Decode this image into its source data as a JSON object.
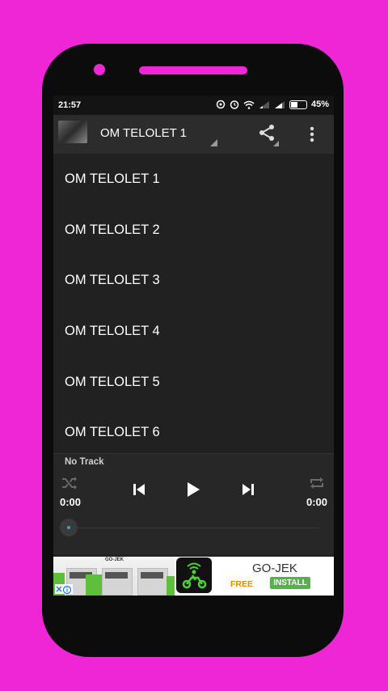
{
  "status_bar": {
    "time": "21:57",
    "battery": "45%"
  },
  "app_bar": {
    "title": "OM TELOLET 1"
  },
  "tracks": [
    {
      "label": "OM TELOLET 1"
    },
    {
      "label": "OM TELOLET 2"
    },
    {
      "label": "OM TELOLET 3"
    },
    {
      "label": "OM TELOLET 4"
    },
    {
      "label": "OM TELOLET 5"
    },
    {
      "label": "OM TELOLET 6"
    }
  ],
  "player": {
    "track_name": "No Track",
    "elapsed": "0:00",
    "duration": "0:00",
    "progress": 0
  },
  "ad": {
    "header": "GO-JEK",
    "app_name": "GO-JEK",
    "price": "FREE",
    "cta": "INSTALL"
  },
  "colors": {
    "background": "#ee26d6",
    "accent_green": "#56b04b",
    "free_orange": "#e38a00"
  }
}
